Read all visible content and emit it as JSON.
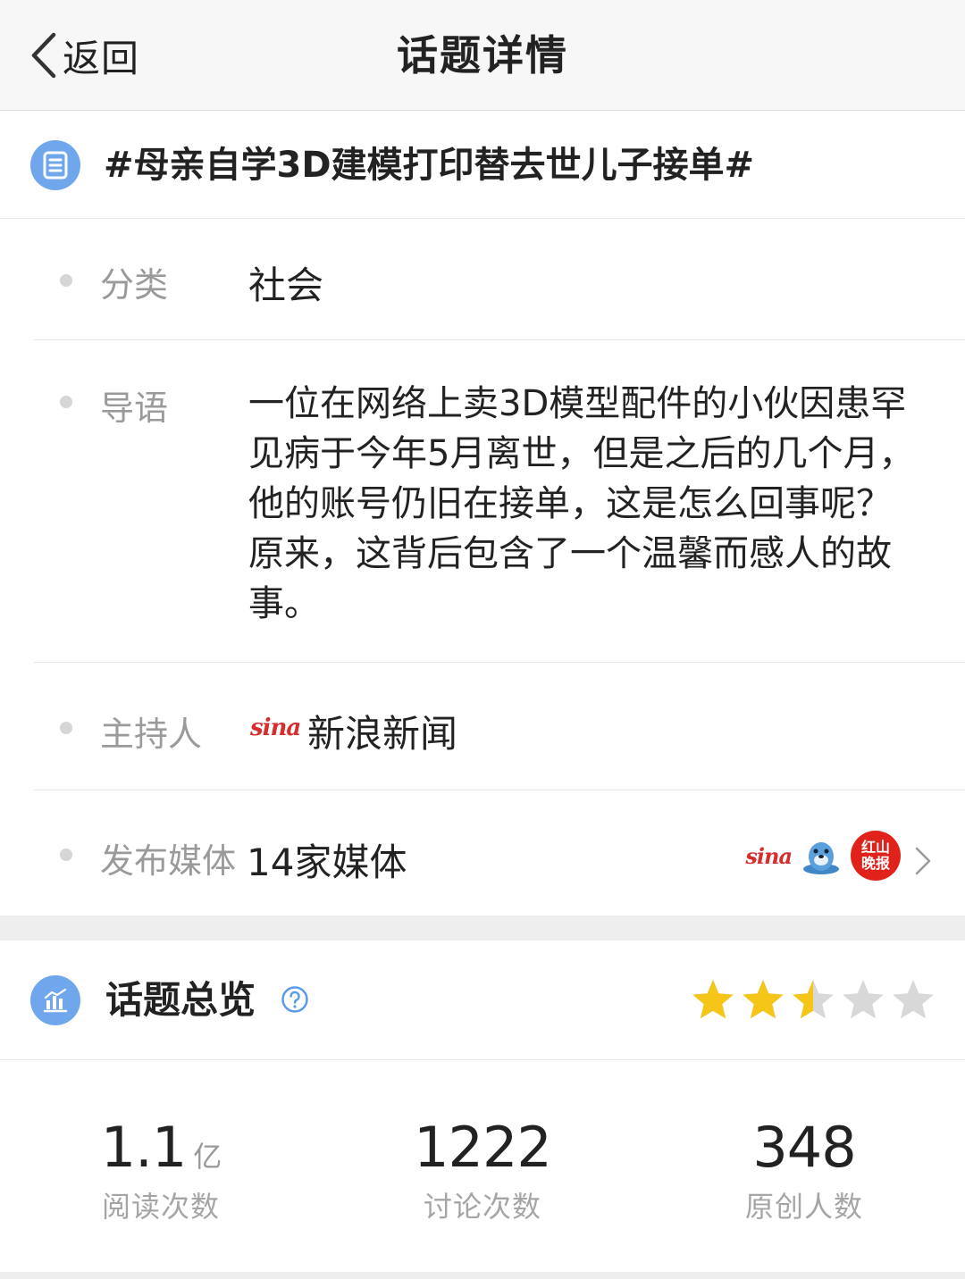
{
  "nav": {
    "back_label": "返回",
    "title": "话题详情"
  },
  "topic": {
    "title": "#母亲自学3D建模打印替去世儿子接单#"
  },
  "info": {
    "category": {
      "label": "分类",
      "value": "社会"
    },
    "intro": {
      "label": "导语",
      "value": "一位在网络上卖3D模型配件的小伙因患罕见病于今年5月离世，但是之后的几个月，他的账号仍旧在接单，这是怎么回事呢？ 原来，这背后包含了一个温馨而感人的故事。"
    },
    "host": {
      "label": "主持人",
      "logo_text": "sina",
      "value": "新浪新闻"
    },
    "media": {
      "label": "发布媒体",
      "value": "14家媒体",
      "icons": [
        "sina-logo",
        "seal-mascot-avatar",
        "hongshan-evening-news-avatar"
      ],
      "sina_logo_text": "sina",
      "hongshan_logo_text": "红山晚报"
    }
  },
  "overview": {
    "title": "话题总览",
    "rating": 2.5,
    "rating_max": 5,
    "star_color": "#f5c518",
    "star_empty_color": "#d8d8d8",
    "stats": [
      {
        "value": "1.1",
        "unit": "亿",
        "label": "阅读次数"
      },
      {
        "value": "1222",
        "unit": "",
        "label": "讨论次数"
      },
      {
        "value": "348",
        "unit": "",
        "label": "原创人数"
      }
    ]
  },
  "colors": {
    "accent": "#6fa6ec",
    "sina_red": "#d62d2d"
  }
}
